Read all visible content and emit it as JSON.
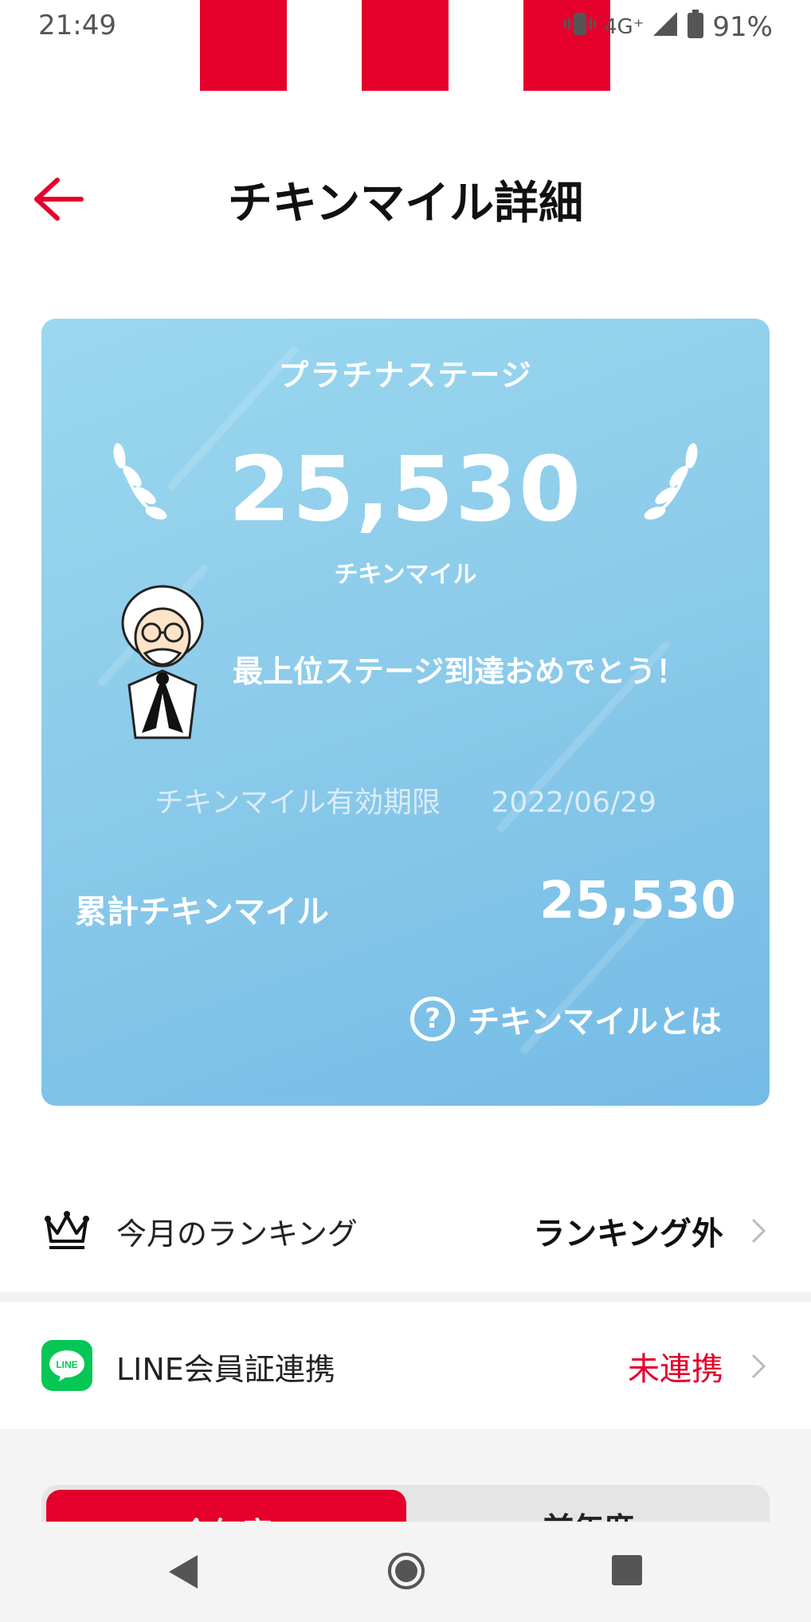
{
  "status_bar": {
    "time": "21:49",
    "network": "4G⁺",
    "battery": "91%",
    "accent_color": "#e4002b"
  },
  "header": {
    "title": "チキンマイル詳細",
    "back_icon": "arrow-left-icon"
  },
  "card": {
    "stage": "プラチナステージ",
    "miles": "25,530",
    "miles_unit": "チキンマイル",
    "congrats": "最上位ステージ到達おめでとう！",
    "expiry_label": "チキンマイル有効期限",
    "expiry_date": "2022/06/29",
    "total_label": "累計チキンマイル",
    "total_value": "25,530",
    "about_label": "チキンマイルとは",
    "about_icon": "question-circle-icon"
  },
  "rows": {
    "ranking": {
      "icon": "crown-icon",
      "label": "今月のランキング",
      "value": "ランキング外",
      "value_color": "#111111"
    },
    "line": {
      "icon": "line-logo-icon",
      "icon_text": "LINE",
      "label": "LINE会員証連携",
      "value": "未連携",
      "value_color": "#e4002b"
    }
  },
  "tabs": {
    "current": "今年度",
    "previous": "前年度"
  }
}
